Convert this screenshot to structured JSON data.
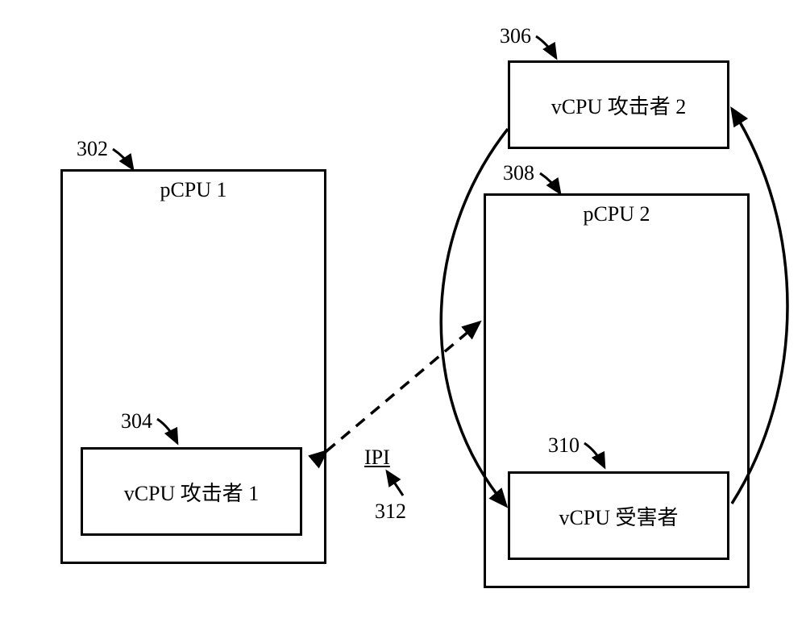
{
  "refs": {
    "pcpu1": "302",
    "vcpu_attacker1": "304",
    "vcpu_attacker2": "306",
    "pcpu2": "308",
    "vcpu_victim": "310",
    "ipi": "312"
  },
  "boxes": {
    "pcpu1_title": "pCPU 1",
    "pcpu2_title": "pCPU 2",
    "vcpu_attacker1": "vCPU 攻击者 1",
    "vcpu_attacker2": "vCPU 攻击者 2",
    "vcpu_victim": "vCPU 受害者"
  },
  "links": {
    "ipi": "IPI"
  }
}
